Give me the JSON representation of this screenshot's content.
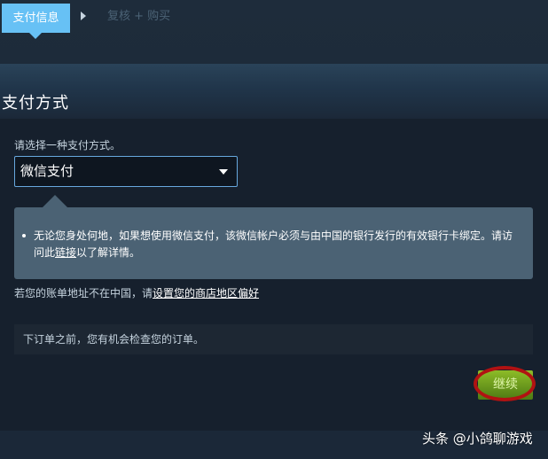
{
  "steps": {
    "active_label": "支付信息",
    "next_label": "复核 + 购买"
  },
  "section": {
    "title": "支付方式"
  },
  "payment": {
    "select_label": "请选择一种支付方式。",
    "selected_method": "微信支付"
  },
  "info": {
    "text_before_link": "无论您身处何地，如果想使用微信支付，该微信帐户必须与由中国的银行发行的有效银行卡绑定。请访问此",
    "link_label": "链接",
    "text_after_link": "以了解详情。"
  },
  "region": {
    "prefix": "若您的账单地址不在中国，请",
    "link_label": "设置您的商店地区偏好"
  },
  "review": {
    "text": "下订单之前，您有机会检查您的订单。"
  },
  "continue_button": {
    "label": "继续"
  },
  "watermark": {
    "text": "头条 @小鸽聊游戏"
  },
  "colors": {
    "background": "#1b2838",
    "panel": "#16202d",
    "active_step": "#67c1f5",
    "info_box": "#4b6274",
    "continue_button": "#6ba21d",
    "highlight_ring": "#b11212"
  }
}
